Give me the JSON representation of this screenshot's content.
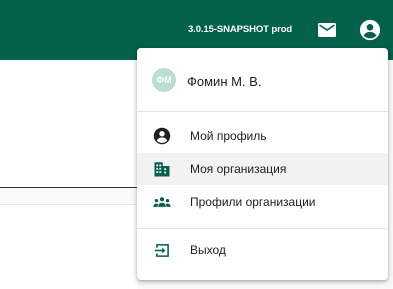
{
  "header": {
    "version_text": "3.0.15-SNAPSHOT prod",
    "mail_icon": "mail-icon",
    "account_icon": "account-circle-icon",
    "background_color": "#03604a"
  },
  "user_menu": {
    "avatar_initials": "ФМ",
    "user_name": "Фомин М. В.",
    "items": [
      {
        "label": "Мой профиль",
        "icon": "account-circle-icon"
      },
      {
        "label": "Моя организация",
        "icon": "building-icon",
        "highlighted": true
      },
      {
        "label": "Профили организации",
        "icon": "group-icon"
      },
      {
        "label": "Выход",
        "icon": "exit-icon"
      }
    ]
  }
}
